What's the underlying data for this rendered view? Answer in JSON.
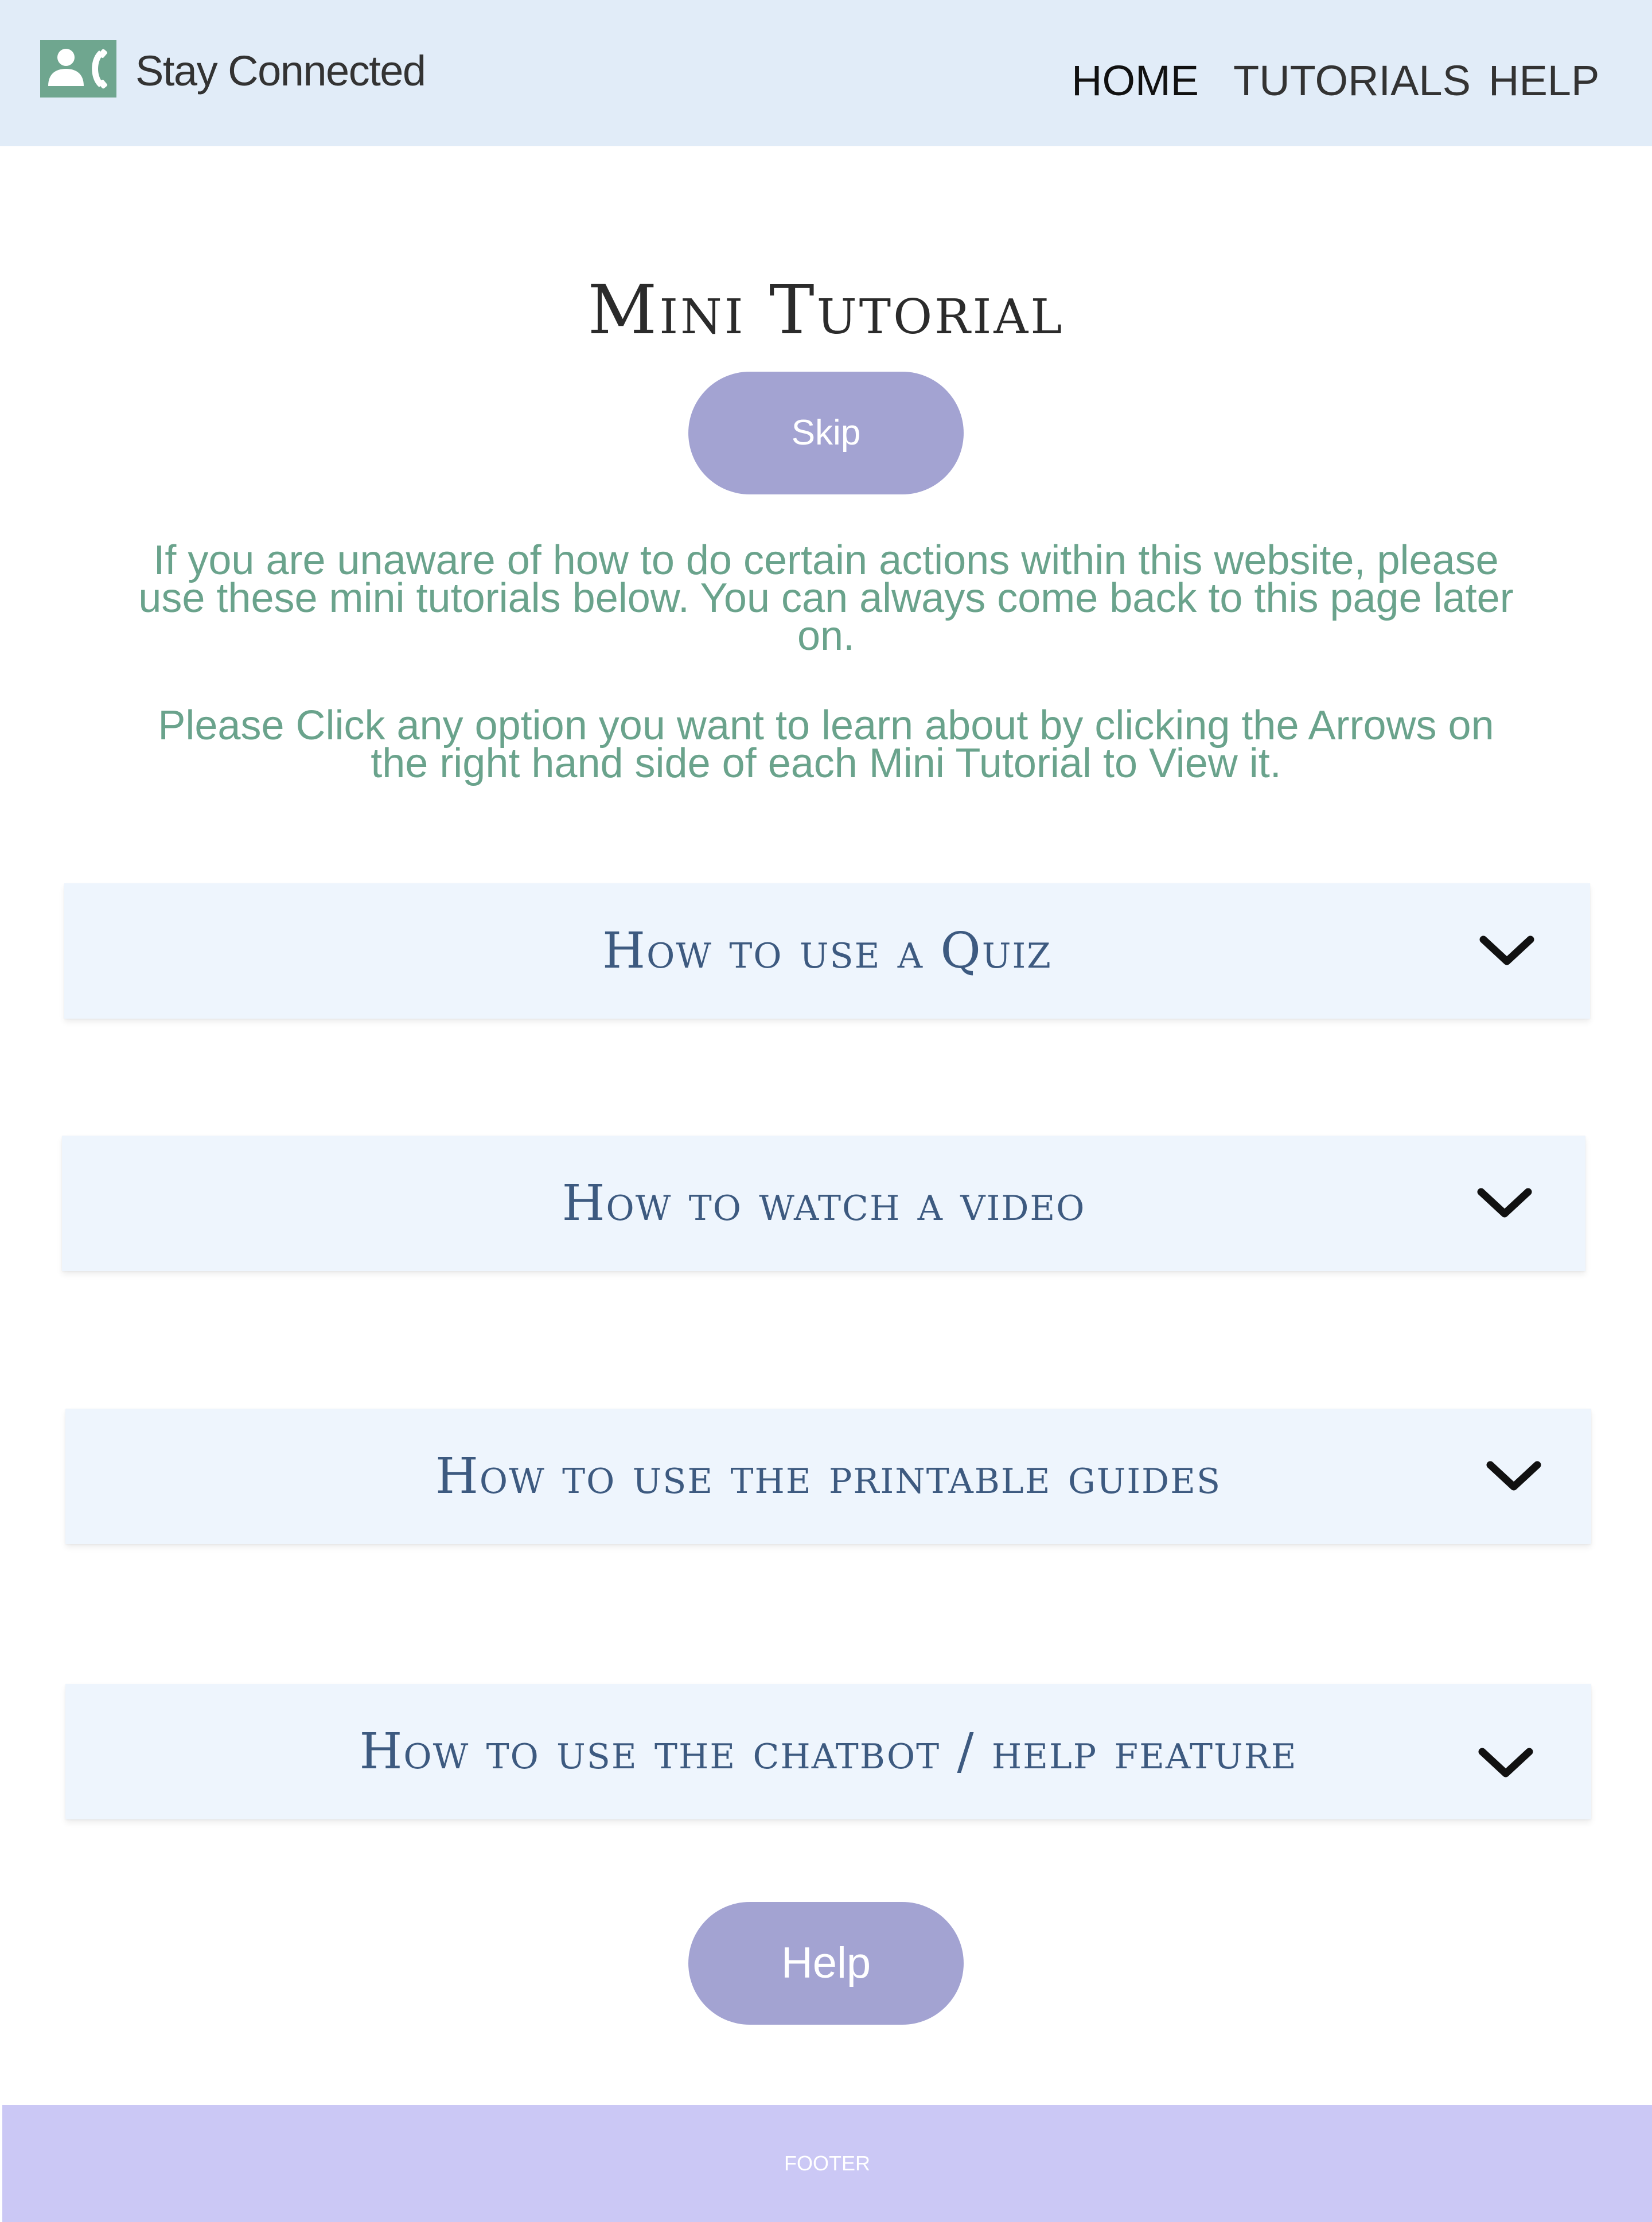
{
  "header": {
    "brand_name": "Stay Connected",
    "logo_icon": "contact-call-icon",
    "nav": {
      "home": "HOME",
      "tutorials": "TUTORIALS",
      "help": "HELP"
    }
  },
  "main": {
    "title": "Mini Tutorial",
    "skip_label": "Skip",
    "intro_paragraph_1": "If you are unaware of how to do certain actions within this website, please use these mini tutorials below. You can always come back to this page later on.",
    "intro_paragraph_2": "Please Click any option you want to learn about by clicking the Arrows on the right hand side of each Mini Tutorial to View it.",
    "tutorials": [
      {
        "title": "How to use a Quiz",
        "icon": "chevron-down-icon"
      },
      {
        "title": "How to watch a video",
        "icon": "chevron-down-icon"
      },
      {
        "title": "How to use the printable guides",
        "icon": "chevron-down-icon"
      },
      {
        "title": "How to use the chatbot / help feature",
        "icon": "chevron-down-icon"
      }
    ],
    "help_label": "Help"
  },
  "footer": {
    "text": "FOOTER"
  },
  "colors": {
    "header_bg": "#e1ecf8",
    "logo_bg": "#6fa68f",
    "accent_button": "#a3a3d2",
    "intro_text": "#6aa38c",
    "card_bg": "#eef5fd",
    "card_title": "#3d5a80",
    "footer_bg": "#cbc8f5"
  }
}
